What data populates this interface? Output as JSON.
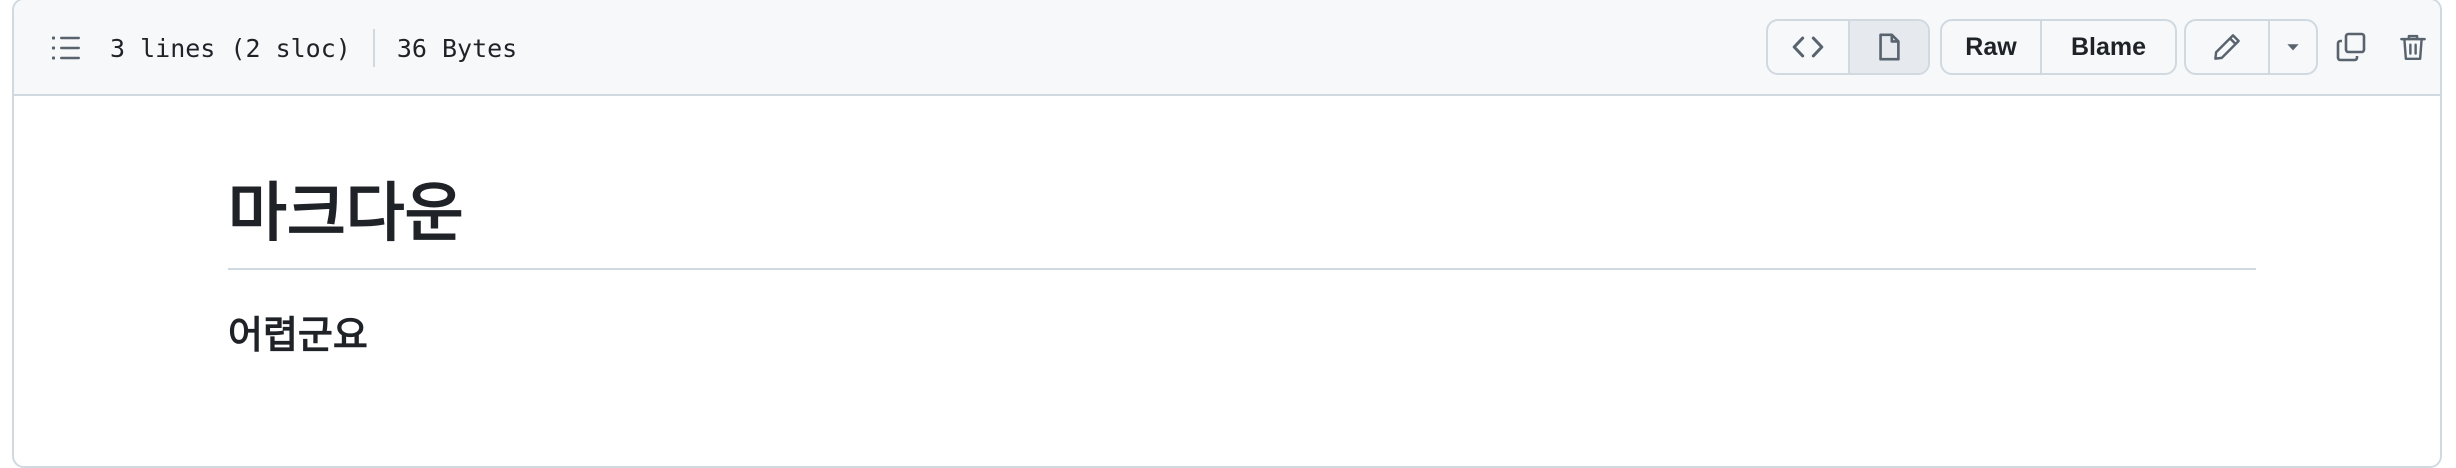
{
  "file_header": {
    "outline_icon": "list-unordered-icon",
    "lines_info": "3 lines (2 sloc)",
    "size_info": "36 Bytes",
    "view_toggle": {
      "code_icon": "code-icon",
      "preview_icon": "file-icon",
      "selected": "preview"
    },
    "raw_label": "Raw",
    "blame_label": "Blame",
    "edit_icon": "pencil-icon",
    "dropdown_icon": "triangle-down-icon",
    "copy_icon": "copy-icon",
    "delete_icon": "trash-icon"
  },
  "content": {
    "heading1": "마크다운",
    "heading2": "어렵군요"
  }
}
